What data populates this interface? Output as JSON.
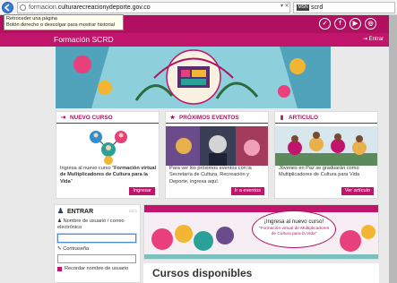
{
  "browser": {
    "url_prefix": "formacion.",
    "url_host": "culturarecreacionydeporte.gov.co",
    "url_controls": "▾ ✕",
    "tab_title": "scrd",
    "tab_favicon": "MSN"
  },
  "tooltip": {
    "line1": "Retroceder una página",
    "line2": "Botón derecho o descolgar para mostrar historial"
  },
  "header": {
    "social": [
      "✓",
      "f",
      "▶",
      "◎"
    ],
    "brand": "Formación SCRD",
    "login_link": "Entrar"
  },
  "cards": [
    {
      "title": "NUEVO CURSO",
      "text_prefix": "Ingresa al nuevo curso \"",
      "text_bold": "Formación virtual de Multiplicadores de Cultura para la Vida",
      "text_suffix": "\"",
      "button": "Ingresar"
    },
    {
      "title": "PRÓXIMOS EVENTOS",
      "text": "Para ver los próximos eventos con la Secretaría de Cultura, Recreación y Deporte, ingresa aquí.",
      "button": "Ir a eventos"
    },
    {
      "title": "ARTICULO",
      "text": "Jóvenes en Paz se graduarán como Multiplicadores de Cultura para Vida",
      "button": "Ver artículo"
    }
  ],
  "login": {
    "title": "ENTRAR",
    "user_label": "Nombre de usuario / correo electrónico",
    "password_label": "Contraseña",
    "remember_label": "Recordar nombre de usuario",
    "user_value": "",
    "password_value": ""
  },
  "promo": {
    "headline": "¡Ingresa al nuevo curso!",
    "subtitle": "\"Formación virtual de Multiplicadores de Cultura para la Vida\""
  },
  "section": {
    "title": "Cursos disponibles"
  },
  "colors": {
    "brand": "#c0156a",
    "brand_dark": "#b0105f"
  }
}
